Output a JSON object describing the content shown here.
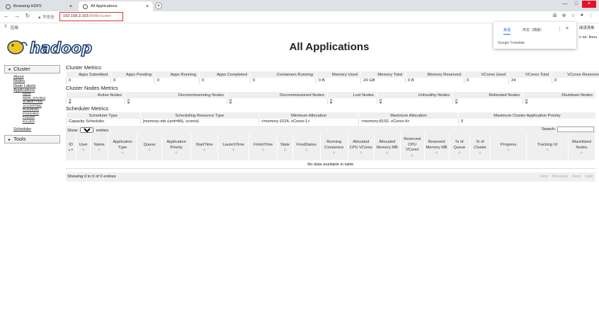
{
  "browser": {
    "tabs": [
      {
        "title": "Browsing HDFS",
        "active": false
      },
      {
        "title": "All Applications",
        "active": true
      }
    ],
    "security_label": "不安全",
    "url_host": "192.168.3.103",
    "url_rest": ":8088/cluster",
    "bookmarks_label": "应用",
    "read_mode_label": "阅读清单"
  },
  "translate_popup": {
    "tab_source": "英语",
    "tab_target": "中文（简体）",
    "brand": "Google Translate"
  },
  "header": {
    "title": "All Applications",
    "logged_in": "n as: linnu",
    "logo_text": "hadoop"
  },
  "sidebar": {
    "cluster_label": "Cluster",
    "links": [
      "About",
      "Nodes",
      "Node Labels",
      "Applications"
    ],
    "app_states": [
      "NEW",
      "NEW_SAVING",
      "SUBMITTED",
      "ACCEPTED",
      "RUNNING",
      "FINISHED",
      "FAILED",
      "KILLED"
    ],
    "scheduler_label": "Scheduler",
    "tools_label": "Tools"
  },
  "cluster_metrics": {
    "title": "Cluster Metrics",
    "headers": [
      "Apps Submitted",
      "Apps Pending",
      "Apps Running",
      "Apps Completed",
      "Containers Running",
      "Memory Used",
      "Memory Total",
      "Memory Reserved",
      "VCores Used",
      "VCores Total",
      "VCores Reserved"
    ],
    "values": [
      "0",
      "0",
      "0",
      "0",
      "0",
      "0 B",
      "24 GB",
      "0 B",
      "0",
      "24",
      "0"
    ]
  },
  "node_metrics": {
    "title": "Cluster Nodes Metrics",
    "headers": [
      "Active Nodes",
      "Decommissioning Nodes",
      "Decommissioned Nodes",
      "Lost Nodes",
      "Unhealthy Nodes",
      "Rebooted Nodes",
      "Shutdown Nodes"
    ],
    "values": [
      "3",
      "0",
      "0",
      "0",
      "0",
      "0",
      "0"
    ]
  },
  "scheduler_metrics": {
    "title": "Scheduler Metrics",
    "headers": [
      "Scheduler Type",
      "Scheduling Resource Type",
      "Minimum Allocation",
      "Maximum Allocation",
      "Maximum Cluster Application Priority"
    ],
    "values": [
      "Capacity Scheduler",
      "[memory-mb (unit=Mi), vcores]",
      "<memory:1024, vCores:1>",
      "<memory:8192, vCores:4>",
      "0"
    ]
  },
  "apps_table": {
    "show_label": "Show",
    "entries_value": "20",
    "entries_label": "entries",
    "search_label": "Search:",
    "headers": [
      "ID",
      "User",
      "Name",
      "Application Type",
      "Queue",
      "Application Priority",
      "StartTime",
      "LaunchTime",
      "FinishTime",
      "State",
      "FinalStatus",
      "Running Containers",
      "Allocated CPU VCores",
      "Allocated Memory MB",
      "Reserved CPU VCores",
      "Reserved Memory MB",
      "% of Queue",
      "% of Cluster",
      "Progress",
      "Tracking UI",
      "Blacklisted Nodes"
    ],
    "empty_message": "No data available in table",
    "info": "Showing 0 to 0 of 0 entries",
    "pager": [
      "First",
      "Previous",
      "Next",
      "Last"
    ]
  }
}
